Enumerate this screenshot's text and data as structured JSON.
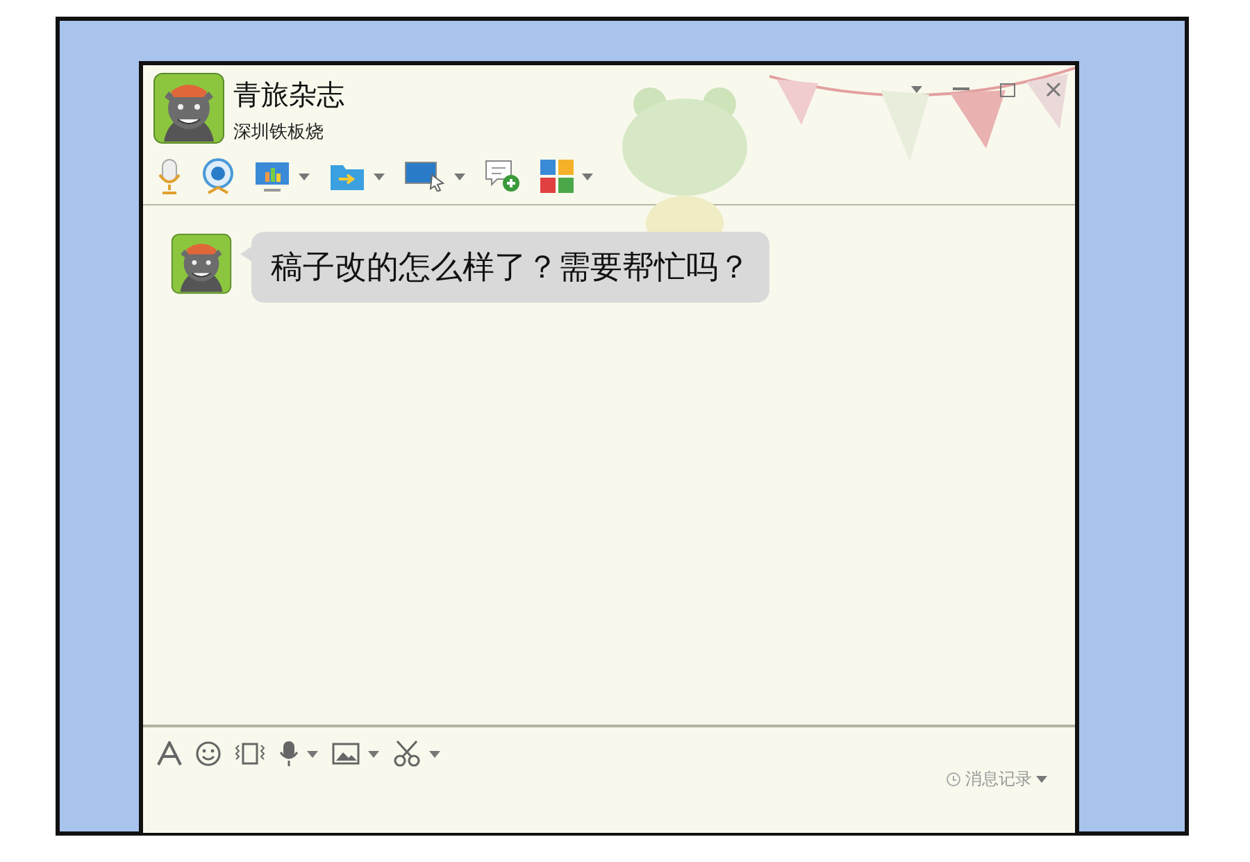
{
  "contact": {
    "name": "青旅杂志",
    "signature": "深圳铁板烧"
  },
  "messages": [
    {
      "text": "稿子改的怎么样了？需要帮忙吗？"
    }
  ],
  "history_button": "消息记录"
}
